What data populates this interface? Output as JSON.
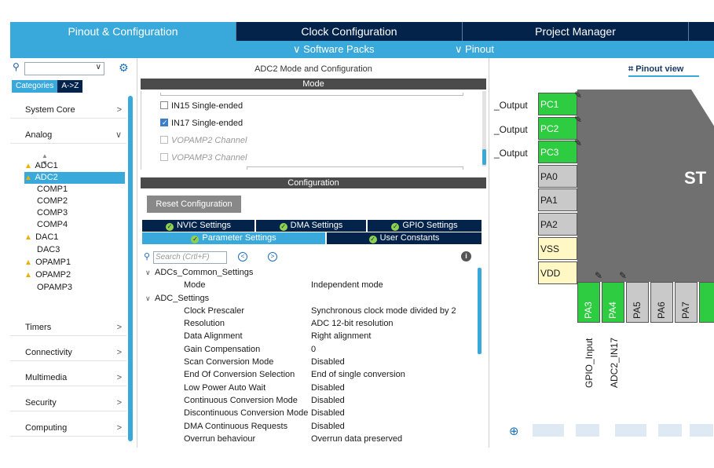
{
  "tabs": [
    {
      "label": "Pinout & Configuration",
      "active": true
    },
    {
      "label": "Clock Configuration",
      "active": false
    },
    {
      "label": "Project Manager",
      "active": false
    }
  ],
  "sub_bar": {
    "software_packs": "∨ Software Packs",
    "pinout": "∨ Pinout"
  },
  "left": {
    "categories_label": "Categories",
    "az_label": "A->Z",
    "groups": [
      "System Core",
      "Analog",
      "Timers",
      "Connectivity",
      "Multimedia",
      "Security",
      "Computing"
    ],
    "analog_items": [
      {
        "label": "ADC1",
        "warn": true,
        "selected": false
      },
      {
        "label": "ADC2",
        "warn": true,
        "selected": true
      },
      {
        "label": "COMP1",
        "warn": false,
        "selected": false
      },
      {
        "label": "COMP2",
        "warn": false,
        "selected": false
      },
      {
        "label": "COMP3",
        "warn": false,
        "selected": false
      },
      {
        "label": "COMP4",
        "warn": false,
        "selected": false
      },
      {
        "label": "DAC1",
        "warn": true,
        "selected": false
      },
      {
        "label": "DAC3",
        "warn": false,
        "selected": false
      },
      {
        "label": "OPAMP1",
        "warn": true,
        "selected": false
      },
      {
        "label": "OPAMP2",
        "warn": true,
        "selected": false
      },
      {
        "label": "OPAMP3",
        "warn": false,
        "selected": false
      }
    ]
  },
  "middle": {
    "title": "ADC2 Mode and Configuration",
    "mode_header": "Mode",
    "mode_items": [
      {
        "label": "IN15 Single-ended",
        "checked": false,
        "disabled": false
      },
      {
        "label": "IN17 Single-ended",
        "checked": true,
        "disabled": false
      },
      {
        "label": "VOPAMP2 Channel",
        "checked": false,
        "disabled": true
      },
      {
        "label": "VOPAMP3 Channel",
        "checked": false,
        "disabled": true
      }
    ],
    "config_header": "Configuration",
    "reset_button": "Reset Configuration",
    "cfg_tabs": {
      "nvic": "NVIC Settings",
      "dma": "DMA Settings",
      "gpio": "GPIO Settings",
      "parameter": "Parameter Settings",
      "user": "User Constants"
    },
    "search_placeholder": "Search (Crtl+F)",
    "groups": {
      "common": "ADCs_Common_Settings",
      "adc": "ADC_Settings"
    },
    "common_params": [
      {
        "k": "Mode",
        "v": "Independent mode"
      }
    ],
    "adc_params": [
      {
        "k": "Clock Prescaler",
        "v": "Synchronous clock mode divided by 2"
      },
      {
        "k": "Resolution",
        "v": "ADC 12-bit resolution"
      },
      {
        "k": "Data Alignment",
        "v": "Right alignment"
      },
      {
        "k": "Gain Compensation",
        "v": "0"
      },
      {
        "k": "Scan Conversion Mode",
        "v": "Disabled"
      },
      {
        "k": "End Of Conversion Selection",
        "v": "End of single conversion"
      },
      {
        "k": "Low Power Auto Wait",
        "v": "Disabled"
      },
      {
        "k": "Continuous Conversion Mode",
        "v": "Disabled"
      },
      {
        "k": "Discontinuous Conversion Mode",
        "v": "Disabled"
      },
      {
        "k": "DMA Continuous Requests",
        "v": "Disabled"
      },
      {
        "k": "Overrun behaviour",
        "v": "Overrun data preserved"
      }
    ]
  },
  "right": {
    "pinout_view": "Pinout view",
    "output_labels": [
      "_Output",
      "_Output",
      "_Output"
    ],
    "chip_text": "ST",
    "left_pins": [
      {
        "label": "PC1",
        "color": "g"
      },
      {
        "label": "PC2",
        "color": "g"
      },
      {
        "label": "PC3",
        "color": "g"
      },
      {
        "label": "PA0",
        "color": "gr"
      },
      {
        "label": "PA1",
        "color": "gr"
      },
      {
        "label": "PA2",
        "color": "gr"
      },
      {
        "label": "VSS",
        "color": "y"
      },
      {
        "label": "VDD",
        "color": "y"
      }
    ],
    "bottom_pins": [
      {
        "label": "PA3",
        "color": "g"
      },
      {
        "label": "PA4",
        "color": "g"
      },
      {
        "label": "PA5",
        "color": "gr"
      },
      {
        "label": "PA6",
        "color": "gr"
      },
      {
        "label": "PA7",
        "color": "gr"
      }
    ],
    "signal_labels": [
      "GPIO_Input",
      "ADC2_IN17"
    ]
  }
}
